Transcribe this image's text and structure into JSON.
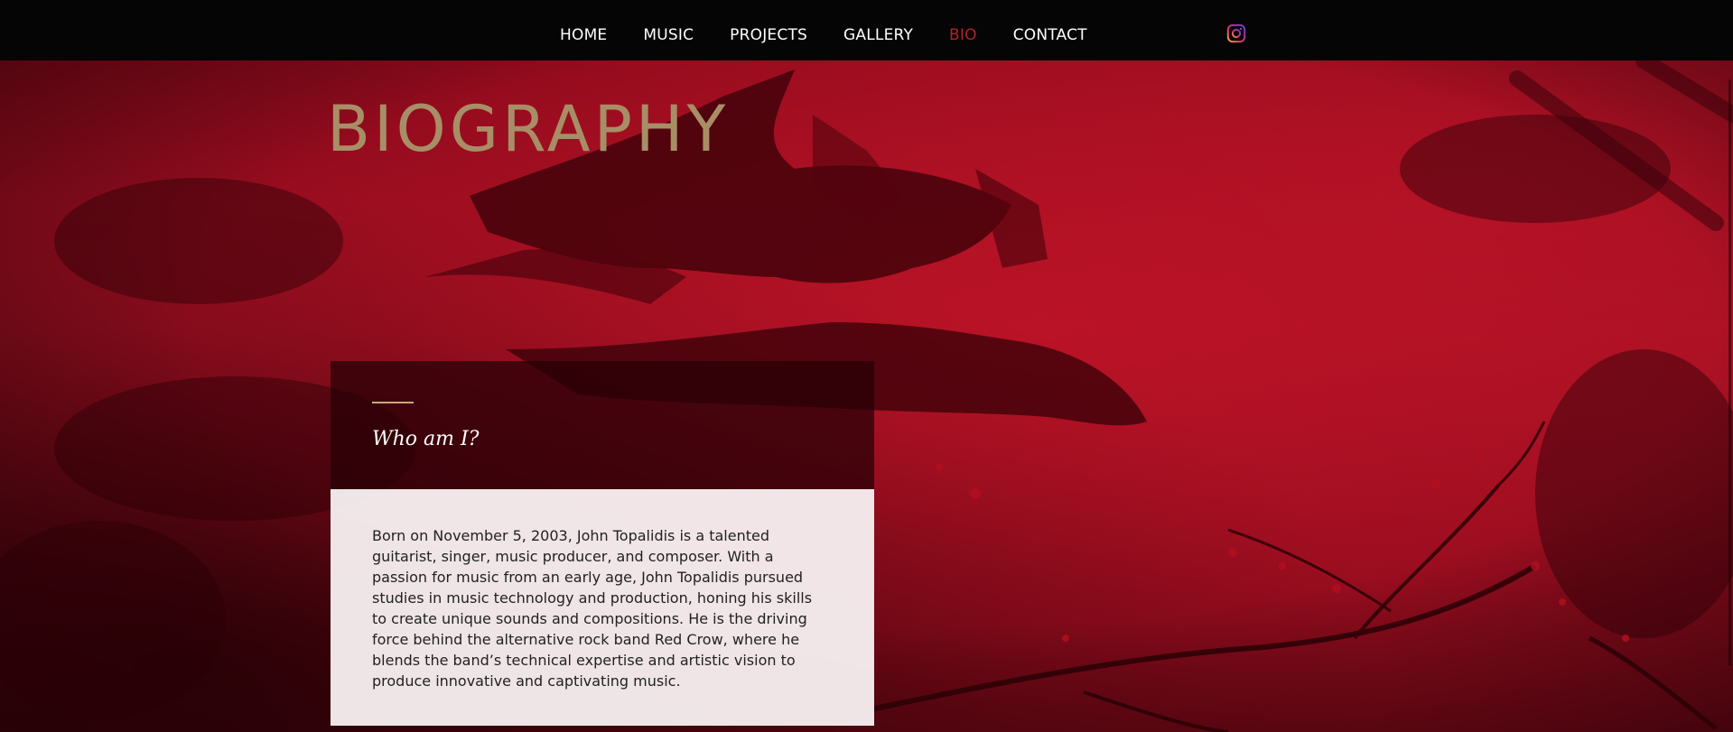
{
  "nav": {
    "items": [
      {
        "label": "HOME"
      },
      {
        "label": "MUSIC"
      },
      {
        "label": "PROJECTS"
      },
      {
        "label": "GALLERY"
      },
      {
        "label": "BIO"
      },
      {
        "label": "CONTACT"
      }
    ],
    "active": "BIO",
    "social_icon": "instagram-icon"
  },
  "page": {
    "title": "BIOGRAPHY"
  },
  "bio": {
    "heading": "Who am I?",
    "text": "Born on November 5, 2003, John Topalidis is a talented guitarist, singer, music producer, and composer. With a passion for music from an early age, John Topalidis pursued studies in music technology and production, honing his skills to create unique sounds and compositions. He is the driving force behind the alternative rock band Red Crow, where he blends the band’s technical expertise and artistic vision to produce innovative and captivating music."
  },
  "colors": {
    "nav_bg": "#050505",
    "nav_text": "#ffffff",
    "nav_active": "#b0222c",
    "hero_red": "#a00f22",
    "title": "#a88e66",
    "card_dark": "#26000699",
    "card_light": "#f6eef0",
    "accent_line": "#c9a97a"
  }
}
